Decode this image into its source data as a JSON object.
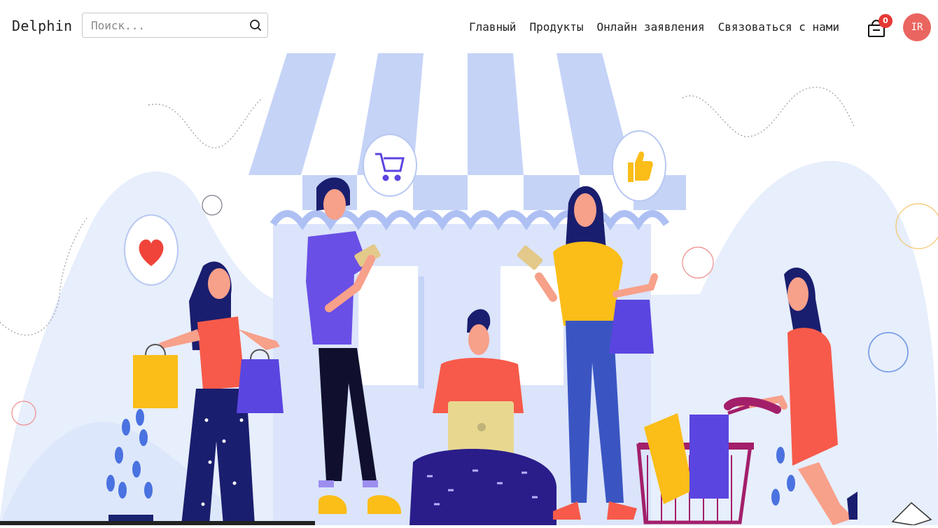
{
  "brand": {
    "name": "Delphin"
  },
  "search": {
    "placeholder": "Поиск..."
  },
  "nav": {
    "items": [
      "Главный",
      "Продукты",
      "Онлайн заявления",
      "Связоваться с нами"
    ]
  },
  "cart": {
    "count": "0"
  },
  "user": {
    "initials": "IR"
  },
  "colors": {
    "accent": "#5b45e0",
    "avatar": "#ea6560",
    "badge": "#e53935",
    "awning": "#c5d3f7",
    "blob": "#e4ecfc",
    "yellow": "#fbbd18",
    "coral": "#f75a4a",
    "navy": "#1a1e6e"
  },
  "hero": {
    "icons": [
      "cart-icon",
      "heart-icon",
      "thumbs-up-icon"
    ]
  }
}
